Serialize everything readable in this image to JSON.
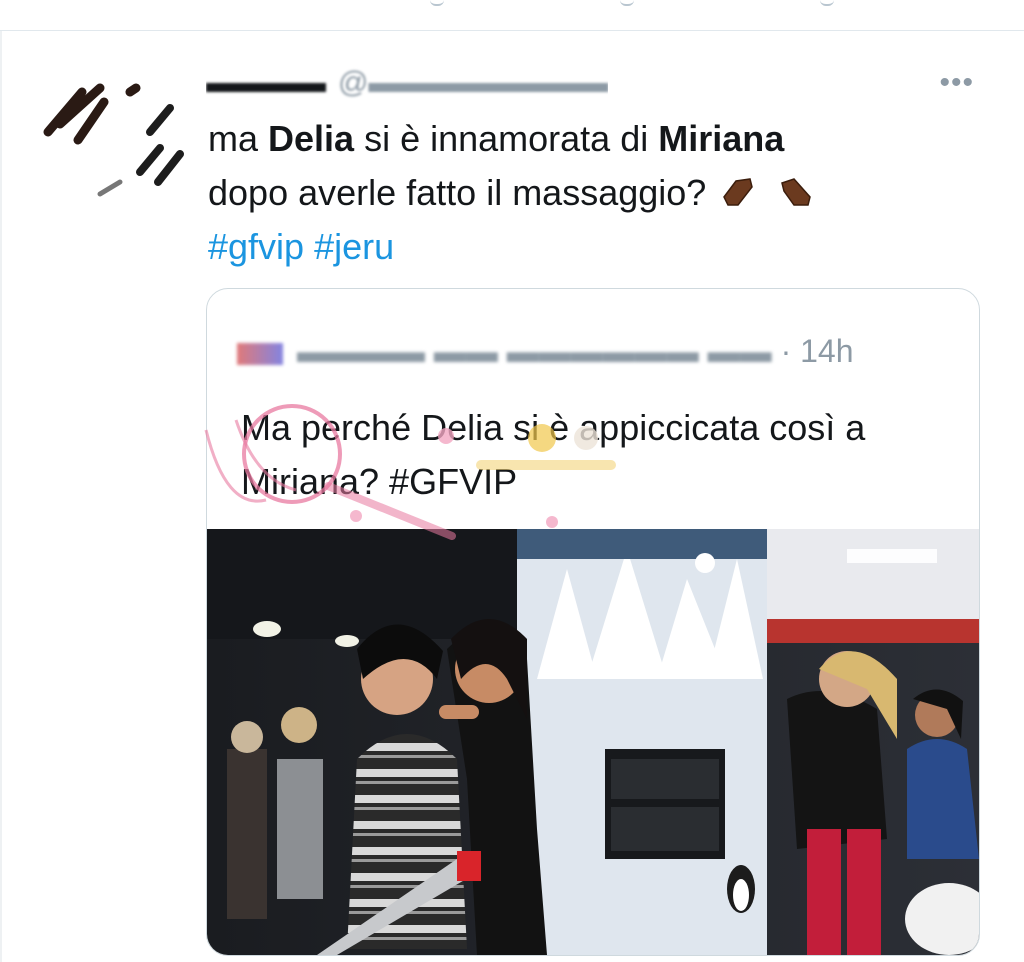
{
  "tweet": {
    "text_part1": "ma ",
    "bold_name1": "Delia",
    "text_part2": " si è innamorata di ",
    "bold_name2": "Miriana",
    "text_part3": "dopo averle fatto il massaggio?",
    "emoji": "coffin-icon",
    "hashtags": [
      "#gfvip",
      "#jeru"
    ],
    "more_label": "•••"
  },
  "quoted_tweet": {
    "time": "· 14h",
    "text": "Ma perché Delia si è appiccicata così a Miriana? #GFVIP"
  },
  "colors": {
    "link": "#1b95e0",
    "text": "#14171a",
    "muted": "#8d9aa5",
    "border": "#cfd9de"
  }
}
